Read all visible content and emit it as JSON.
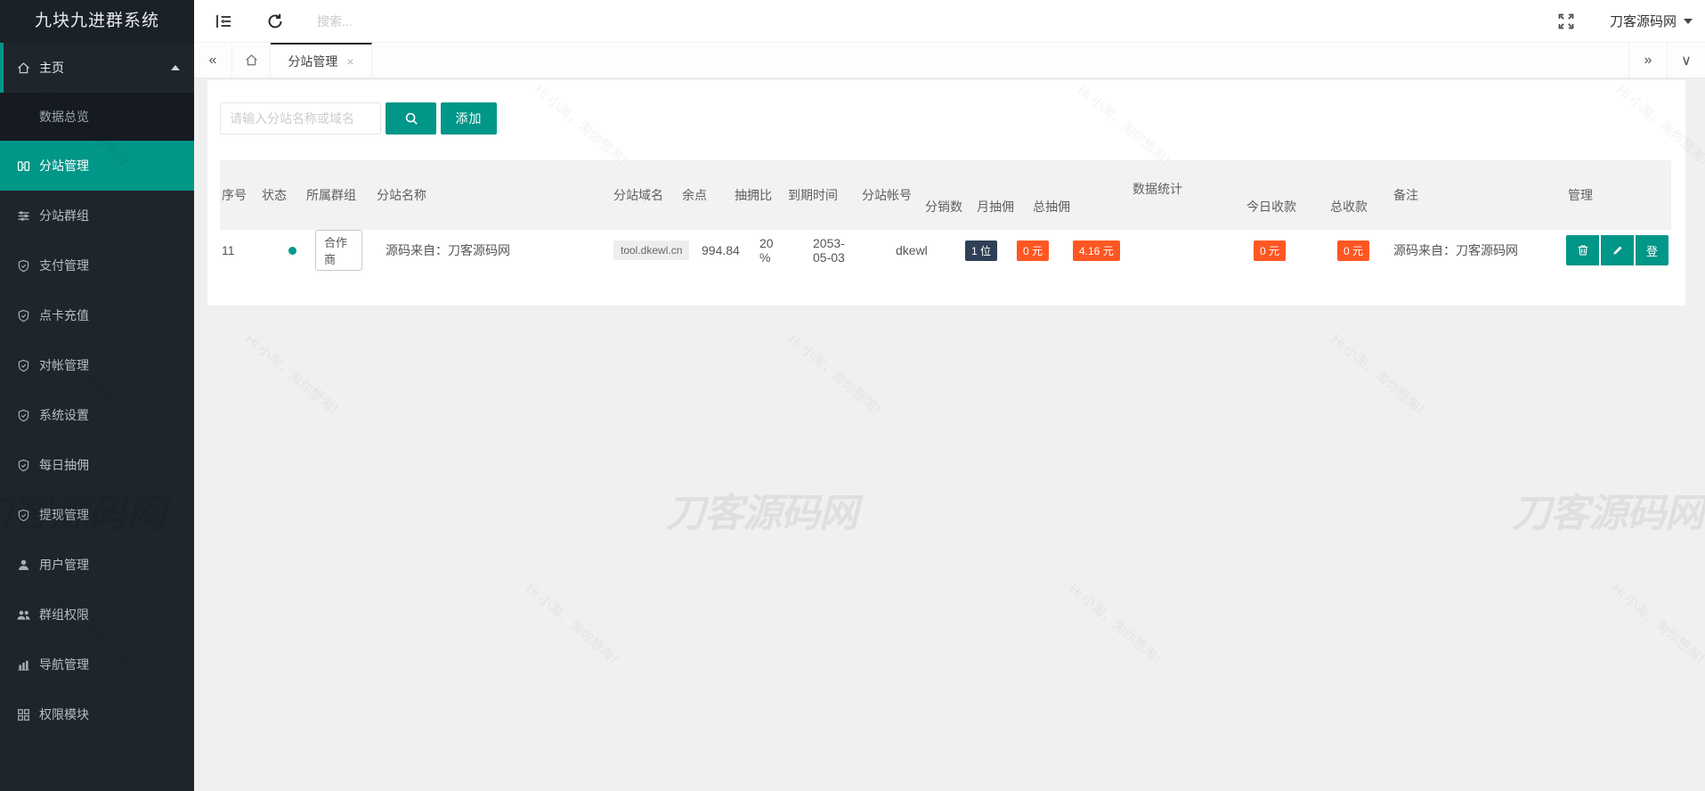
{
  "app": {
    "title": "九块九进群系统"
  },
  "topbar": {
    "search_placeholder": "搜索...",
    "username": "刀客源码网"
  },
  "tabbar": {
    "active_tab": "分站管理",
    "close_glyph": "×",
    "back_glyph": "«",
    "forward_glyph": "»",
    "more_glyph": "∨"
  },
  "sidebar": {
    "items": [
      {
        "label": "主页"
      },
      {
        "label": "数据总览"
      },
      {
        "label": "分站管理"
      },
      {
        "label": "分站群组"
      },
      {
        "label": "支付管理"
      },
      {
        "label": "点卡充值"
      },
      {
        "label": "对帐管理"
      },
      {
        "label": "系统设置"
      },
      {
        "label": "每日抽佣"
      },
      {
        "label": "提现管理"
      },
      {
        "label": "用户管理"
      },
      {
        "label": "群组权限"
      },
      {
        "label": "导航管理"
      },
      {
        "label": "权限模块"
      }
    ]
  },
  "toolbar": {
    "filter_placeholder": "请输入分站名称或域名",
    "add_label": "添加"
  },
  "table": {
    "headers": {
      "seq": "序号",
      "status": "状态",
      "group": "所属群组",
      "site_name": "分站名称",
      "domain": "分站域名",
      "balance": "余点",
      "commission_rate": "抽拥比",
      "expire": "到期时间",
      "account": "分站帐号",
      "stats_group": "数据统计",
      "distributors": "分销数",
      "month_commission": "月抽佣",
      "total_commission": "总抽佣",
      "today_income": "今日收款",
      "total_income": "总收款",
      "remark": "备注",
      "manage": "管理"
    },
    "row": {
      "seq": "11",
      "group_tag": "合作商",
      "site_name": "源码来自：刀客源码网",
      "domain": "tool.dkewl.cn",
      "balance": "994.84",
      "commission_rate": "20 %",
      "expire": "2053-05-03",
      "account": "dkewl",
      "distributors": "1 位",
      "month_commission": "0 元",
      "total_commission": "4.16 元",
      "today_income": "0 元",
      "total_income": "0 元",
      "remark": "源码来自：刀客源码网",
      "login_label": "登"
    }
  },
  "watermark": {
    "small_text": "Hi 小淘，淘你想淘！",
    "big_text": "刀客源码网"
  },
  "colors": {
    "teal": "#009688",
    "orange": "#FF5722",
    "navy": "#2F4056",
    "status_dot": "#009B8A",
    "sidebar_bg": "#1F252D"
  }
}
